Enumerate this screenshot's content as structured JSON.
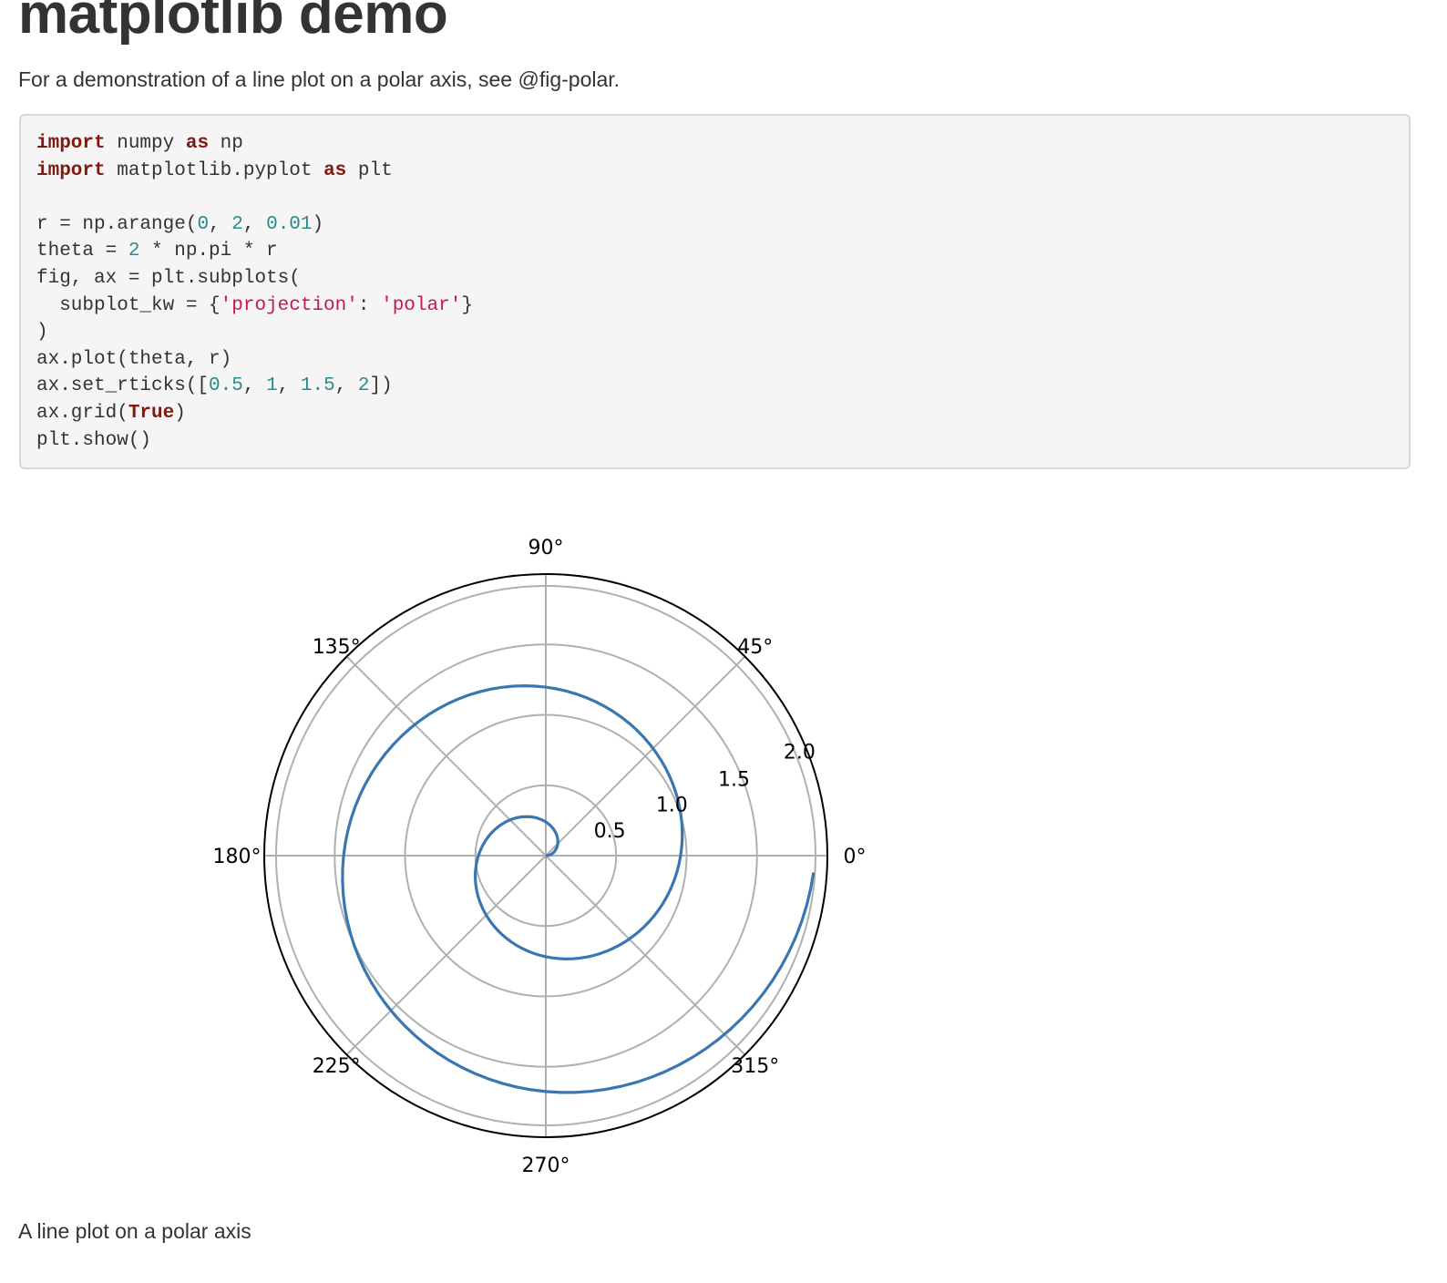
{
  "page": {
    "title": "matplotlib demo",
    "intro": "For a demonstration of a line plot on a polar axis, see @fig-polar.",
    "caption": "A line plot on a polar axis"
  },
  "code": {
    "lines": [
      [
        {
          "t": "import",
          "c": "kw"
        },
        {
          "t": " numpy ",
          "c": ""
        },
        {
          "t": "as",
          "c": "kw"
        },
        {
          "t": " np",
          "c": ""
        }
      ],
      [
        {
          "t": "import",
          "c": "kw"
        },
        {
          "t": " matplotlib.pyplot ",
          "c": ""
        },
        {
          "t": "as",
          "c": "kw"
        },
        {
          "t": " plt",
          "c": ""
        }
      ],
      [],
      [
        {
          "t": "r = np.arange(",
          "c": ""
        },
        {
          "t": "0",
          "c": "num"
        },
        {
          "t": ", ",
          "c": ""
        },
        {
          "t": "2",
          "c": "num"
        },
        {
          "t": ", ",
          "c": ""
        },
        {
          "t": "0.01",
          "c": "num"
        },
        {
          "t": ")",
          "c": ""
        }
      ],
      [
        {
          "t": "theta = ",
          "c": ""
        },
        {
          "t": "2",
          "c": "num"
        },
        {
          "t": " * np.pi * r",
          "c": ""
        }
      ],
      [
        {
          "t": "fig, ax = plt.subplots(",
          "c": ""
        }
      ],
      [
        {
          "t": "  subplot_kw = {",
          "c": ""
        },
        {
          "t": "'projection'",
          "c": "str"
        },
        {
          "t": ": ",
          "c": ""
        },
        {
          "t": "'polar'",
          "c": "str"
        },
        {
          "t": "}",
          "c": ""
        }
      ],
      [
        {
          "t": ")",
          "c": ""
        }
      ],
      [
        {
          "t": "ax.plot(theta, r)",
          "c": ""
        }
      ],
      [
        {
          "t": "ax.set_rticks([",
          "c": ""
        },
        {
          "t": "0.5",
          "c": "num"
        },
        {
          "t": ", ",
          "c": ""
        },
        {
          "t": "1",
          "c": "num"
        },
        {
          "t": ", ",
          "c": ""
        },
        {
          "t": "1.5",
          "c": "num"
        },
        {
          "t": ", ",
          "c": ""
        },
        {
          "t": "2",
          "c": "num"
        },
        {
          "t": "])",
          "c": ""
        }
      ],
      [
        {
          "t": "ax.grid(",
          "c": ""
        },
        {
          "t": "True",
          "c": "kw"
        },
        {
          "t": ")",
          "c": ""
        }
      ],
      [
        {
          "t": "plt.show()",
          "c": ""
        }
      ]
    ]
  },
  "chart_data": {
    "type": "line",
    "projection": "polar",
    "title": "",
    "series": [
      {
        "r_start": 0,
        "r_stop": 2,
        "r_step": 0.01,
        "theta_formula": "theta = 2 * pi * r",
        "color": "#3a76b0"
      }
    ],
    "rlim": [
      0,
      2
    ],
    "rticks": [
      "0.5",
      "1.0",
      "1.5",
      "2.0"
    ],
    "theta_ticks": [
      "0°",
      "45°",
      "90°",
      "135°",
      "180°",
      "225°",
      "270°",
      "315°"
    ],
    "grid": true,
    "colors": {
      "line": "#3a76b0",
      "grid": "#b0b0b0",
      "spine": "#000000"
    }
  }
}
